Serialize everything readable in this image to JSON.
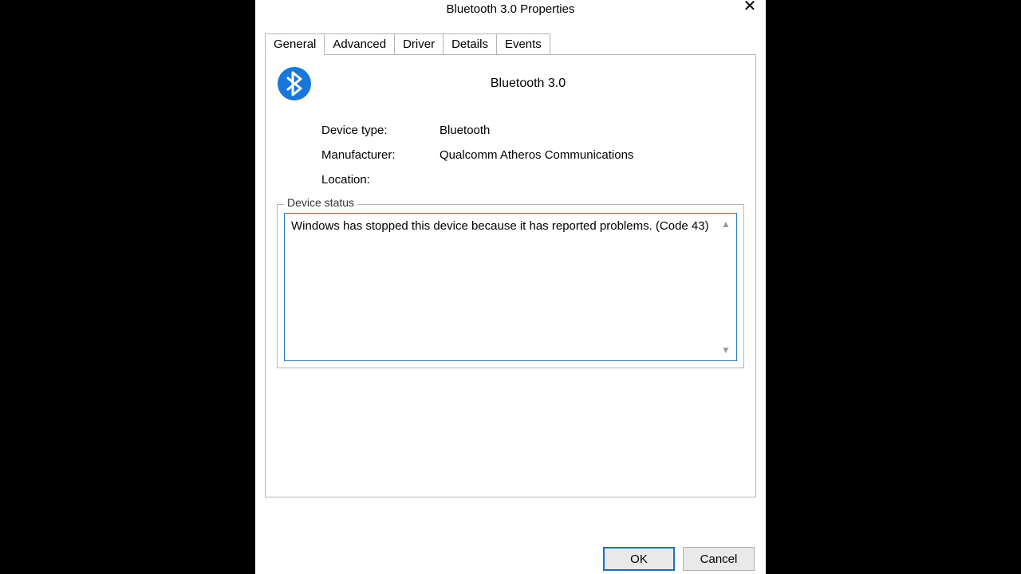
{
  "window": {
    "title": "Bluetooth 3.0 Properties"
  },
  "tabs": {
    "general": "General",
    "advanced": "Advanced",
    "driver": "Driver",
    "details": "Details",
    "events": "Events"
  },
  "device": {
    "name": "Bluetooth 3.0",
    "type_label": "Device type:",
    "type_value": "Bluetooth",
    "manufacturer_label": "Manufacturer:",
    "manufacturer_value": "Qualcomm Atheros Communications",
    "location_label": "Location:",
    "location_value": ""
  },
  "status": {
    "legend": "Device status",
    "text": "Windows has stopped this device because it has reported problems. (Code 43)"
  },
  "buttons": {
    "ok": "OK",
    "cancel": "Cancel"
  }
}
